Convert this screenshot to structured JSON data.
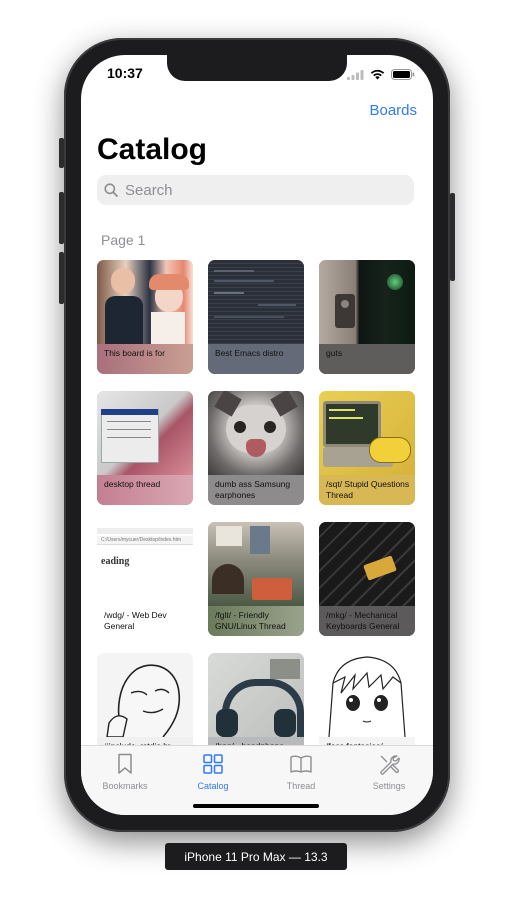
{
  "status": {
    "time": "10:37"
  },
  "nav": {
    "right_button": "Boards"
  },
  "page": {
    "title": "Catalog"
  },
  "search": {
    "placeholder": "Search"
  },
  "catalog": {
    "page_label": "Page 1",
    "threads": [
      {
        "subject": "This board is for",
        "thumb": "two-people-anime-photo"
      },
      {
        "subject": "Best Emacs distro",
        "thumb": "dark-code-editor"
      },
      {
        "subject": "guts",
        "thumb": "speaker-green-light"
      },
      {
        "subject": "desktop thread",
        "thumb": "desktop-window-screenshot"
      },
      {
        "subject": "dumb ass Samsung earphones",
        "thumb": "screaming-cat"
      },
      {
        "subject": "/sqt/ Stupid Questions Thread",
        "thumb": "yellow-hand-typing-terminal"
      },
      {
        "subject": "/wdg/ - Web Dev General",
        "thumb": "browser-page-heading"
      },
      {
        "subject": "/fglt/ - Friendly GNU/Linux Thread",
        "thumb": "person-at-laptop"
      },
      {
        "subject": "/mkg/ - Mechanical Keyboards General",
        "thumb": "black-keyboard-keys"
      },
      {
        "subject": "#include <stdio.h>",
        "thumb": "wojak-face-drawing"
      },
      {
        "subject": "/hpg/ - headphone",
        "thumb": "headphones"
      },
      {
        "subject": "/foss fantasies/",
        "thumb": "anime-girl-sketch"
      }
    ]
  },
  "tabbar": {
    "items": [
      {
        "label": "Bookmarks",
        "icon": "bookmark-icon",
        "active": false
      },
      {
        "label": "Catalog",
        "icon": "grid-icon",
        "active": true
      },
      {
        "label": "Thread",
        "icon": "book-icon",
        "active": false
      },
      {
        "label": "Settings",
        "icon": "wrench-icon",
        "active": false
      }
    ]
  },
  "device": {
    "label": "iPhone 11 Pro Max — 13.3"
  },
  "colors": {
    "accent": "#2f7bf5",
    "inactive": "#8e8e93"
  }
}
